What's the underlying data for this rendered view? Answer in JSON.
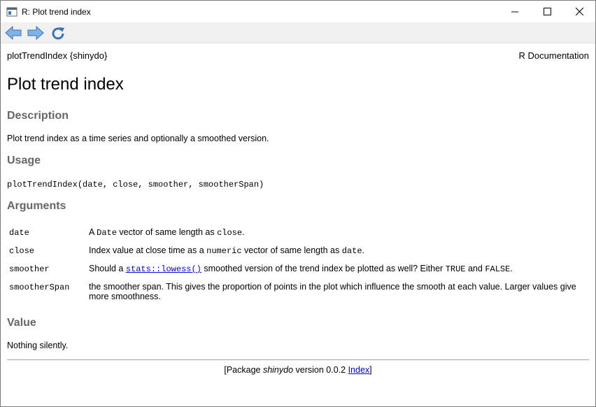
{
  "window": {
    "title": "R: Plot trend index"
  },
  "toolbar": {
    "back": "back",
    "forward": "forward",
    "refresh": "refresh"
  },
  "header": {
    "topic": "plotTrendIndex {shinydo}",
    "right": "R Documentation"
  },
  "page": {
    "title": "Plot trend index"
  },
  "description": {
    "heading": "Description",
    "text": "Plot trend index as a time series and optionally a smoothed version."
  },
  "usage": {
    "heading": "Usage",
    "code": "plotTrendIndex(date, close, smoother, smootherSpan)"
  },
  "arguments": {
    "heading": "Arguments",
    "items": [
      {
        "name": "date",
        "t1": "A ",
        "c1": "Date",
        "t2": " vector of same length as ",
        "c2": "close",
        "t3": "."
      },
      {
        "name": "close",
        "t1": "Index value at close time as a ",
        "c1": "numeric",
        "t2": " vector of same length as ",
        "c2": "date",
        "t3": "."
      },
      {
        "name": "smoother",
        "t1": "Should a ",
        "link": "stats::lowess()",
        "t2": " smoothed version of the trend index be plotted as well? Either ",
        "c1": "TRUE",
        "t3": " and ",
        "c2": "FALSE",
        "t4": "."
      },
      {
        "name": "smootherSpan",
        "text": "the smoother span. This gives the proportion of points in the plot which influence the smooth at each value. Larger values give more smoothness."
      }
    ]
  },
  "value": {
    "heading": "Value",
    "text": "Nothing silently."
  },
  "footer": {
    "prefix": "[Package ",
    "pkg": "shinydo",
    "version": " version 0.0.2 ",
    "index": "Index",
    "suffix": "]"
  }
}
